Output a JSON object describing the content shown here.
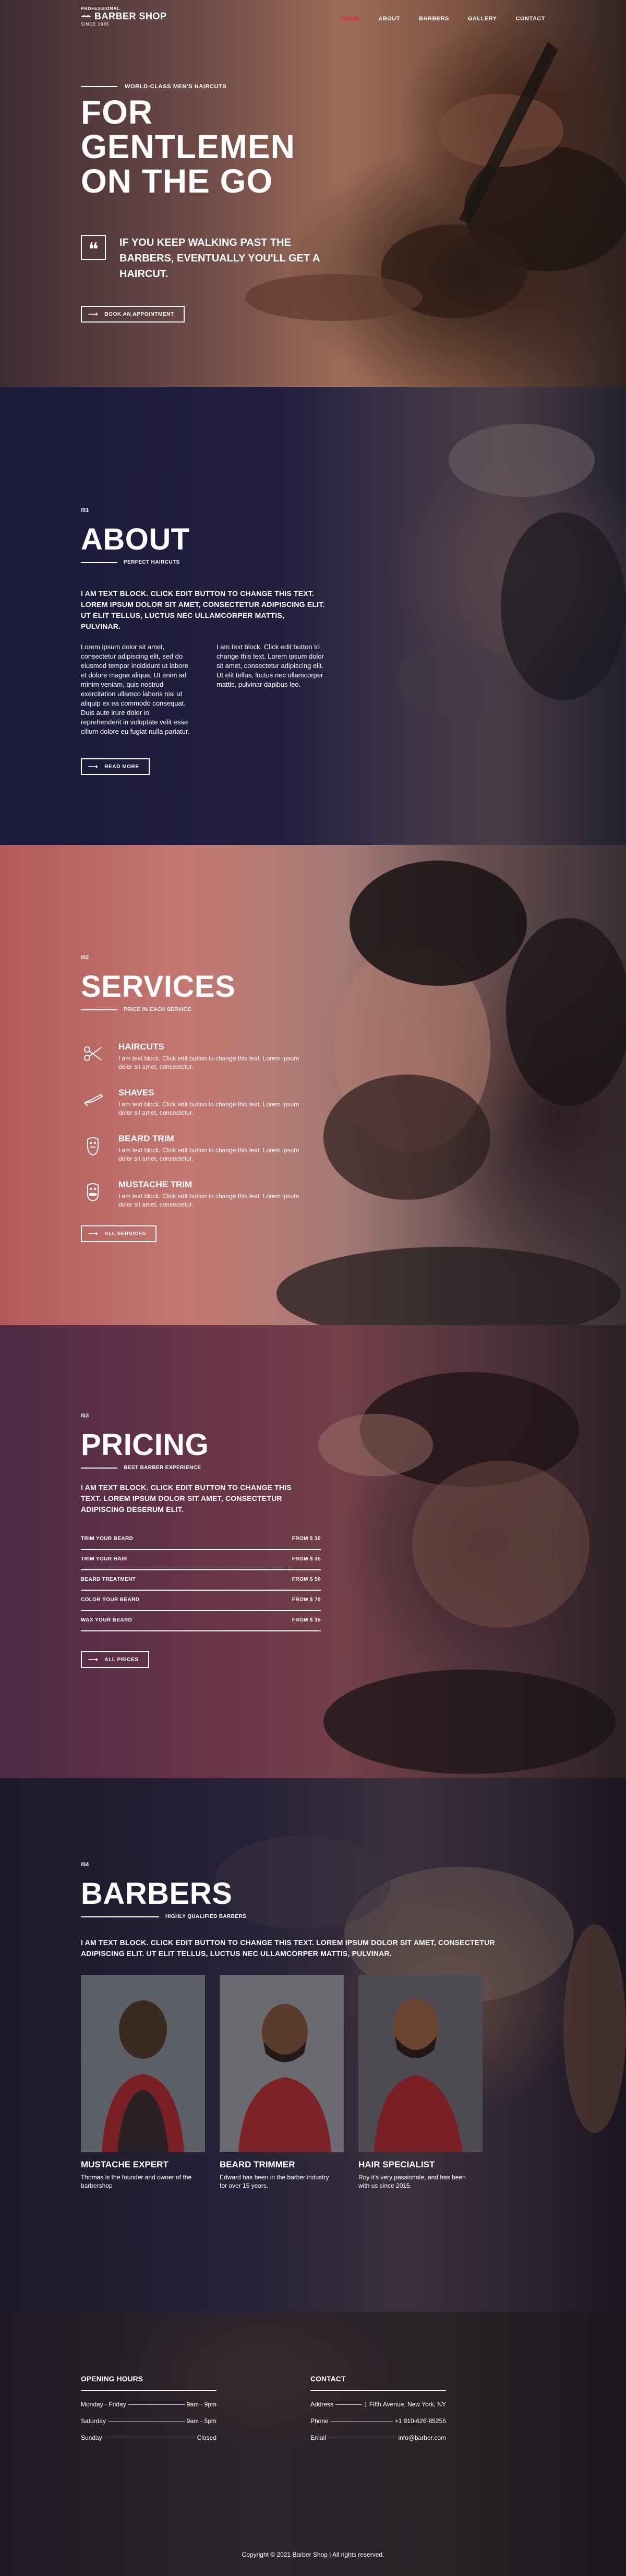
{
  "nav": {
    "logo_top": "PROFESSIONAL",
    "logo_main": "BARBER SHOP",
    "logo_sub": "SINCE 1985",
    "items": [
      {
        "label": "HOME",
        "active": true
      },
      {
        "label": "ABOUT",
        "active": false
      },
      {
        "label": "BARBERS",
        "active": false
      },
      {
        "label": "GALLERY",
        "active": false
      },
      {
        "label": "CONTACT",
        "active": false
      }
    ],
    "accent": "#e8282f"
  },
  "hero": {
    "kicker": "WORLD-CLASS MEN'S HAIRCUTS",
    "title_line1": "FOR",
    "title_line2": "GENTLEMEN",
    "title_line3": "ON THE GO",
    "quote": "IF YOU KEEP WALKING PAST THE BARBERS, EVENTUALLY YOU'LL GET A HAIRCUT.",
    "button": "BOOK AN APPOINTMENT"
  },
  "about": {
    "number": "/01",
    "title": "ABOUT",
    "subtitle": "PERFECT HAIRCUTS",
    "lead": "I AM TEXT BLOCK. CLICK EDIT BUTTON TO CHANGE THIS TEXT. LOREM IPSUM DOLOR SIT AMET, CONSECTETUR ADIPISCING ELIT. UT ELIT TELLUS, LUCTUS NEC ULLAMCORPER MATTIS, PULVINAR.",
    "col1": "Lorem ipsum dolor sit amet, consectetur adipiscing elit, sed do eiusmod tempor incididunt ut labore et dolore magna aliqua. Ut enim ad minim veniam, quis nostrud exercitation ullamco laboris nisi ut aliquip ex ea commodo consequat. Duis aute irure dolor in reprehenderit in voluptate velit esse cillum dolore eu fugiat nulla pariatur.",
    "col2": "I am text block. Click edit button to change this text. Lorem ipsum dolor sit amet, consectetur adipiscing elit. Ut elit tellus, luctus nec ullamcorper mattis, pulvinar dapibus leo.",
    "button": "READ MORE"
  },
  "services": {
    "number": "/02",
    "title": "SERVICES",
    "subtitle": "PRICE IN EACH SERVICE",
    "items": [
      {
        "title": "HAIRCUTS",
        "desc": "I am text block. Click edit button to change this text. Lorem ipsum dolor sit amet, consectetur.",
        "icon": "scissors-icon"
      },
      {
        "title": "SHAVES",
        "desc": "I am text block. Click edit button to change this text. Lorem ipsum dolor sit amet, consectetur.",
        "icon": "razor-icon"
      },
      {
        "title": "BEARD TRIM",
        "desc": "I am text block. Click edit button to change this text. Lorem ipsum dolor sit amet, consectetur.",
        "icon": "beard-icon"
      },
      {
        "title": "MUSTACHE TRIM",
        "desc": "I am text block. Click edit button to change this text. Lorem ipsum dolor sit amet, consectetur.",
        "icon": "mustache-icon"
      }
    ],
    "button": "ALL SERVICES"
  },
  "pricing": {
    "number": "/03",
    "title": "PRICING",
    "subtitle": "BEST BARBER EXPERIENCE",
    "lead": "I AM TEXT BLOCK. CLICK EDIT BUTTON TO CHANGE THIS TEXT. LOREM IPSUM DOLOR SIT AMET, CONSECTETUR ADIPISCING DESERUM ELIT.",
    "rows": [
      {
        "label": "TRIM YOUR BEARD",
        "price": "FROM $ 30"
      },
      {
        "label": "TRIM YOUR HAIR",
        "price": "FROM $ 35"
      },
      {
        "label": "BEARD TREATMENT",
        "price": "FROM $ 50"
      },
      {
        "label": "COLOR YOUR BEARD",
        "price": "FROM $ 70"
      },
      {
        "label": "WAX YOUR BEARD",
        "price": "FROM $ 35"
      }
    ],
    "button": "ALL PRICES"
  },
  "barbers": {
    "number": "/04",
    "title": "BARBERS",
    "subtitle": "HIGHLY QUALIFIED BARBERS",
    "lead": "I AM TEXT BLOCK. CLICK EDIT BUTTON TO CHANGE THIS TEXT. LOREM IPSUM DOLOR SIT AMET, CONSECTETUR ADIPISCING ELIT. UT ELIT TELLUS, LUCTUS NEC ULLAMCORPER MATTIS, PULVINAR.",
    "cards": [
      {
        "name": "MUSTACHE EXPERT",
        "desc": "Thomas is the founder and owner of the barbershop"
      },
      {
        "name": "BEARD TRIMMER",
        "desc": "Edward has been in the barber industry for over 15 years."
      },
      {
        "name": "HAIR SPECIALIST",
        "desc": "Roy it's very passionate, and has been with us since 2015."
      }
    ]
  },
  "footer": {
    "hours_title": "OPENING HOURS",
    "hours": [
      {
        "day": "Monday - Friday",
        "time": "9am - 9pm"
      },
      {
        "day": "Saturday",
        "time": "9am - 5pm"
      },
      {
        "day": "Sunday",
        "time": "Closed"
      }
    ],
    "contact_title": "CONTACT",
    "contact": [
      {
        "key": "Address",
        "value": "1 Fifth Avenue, New York, NY"
      },
      {
        "key": "Phone",
        "value": "+1 910-626-85255"
      },
      {
        "key": "Email",
        "value": "info@barber.com"
      }
    ],
    "copyright": "Copyright © 2021 Barber Shop | All rights reserved."
  }
}
